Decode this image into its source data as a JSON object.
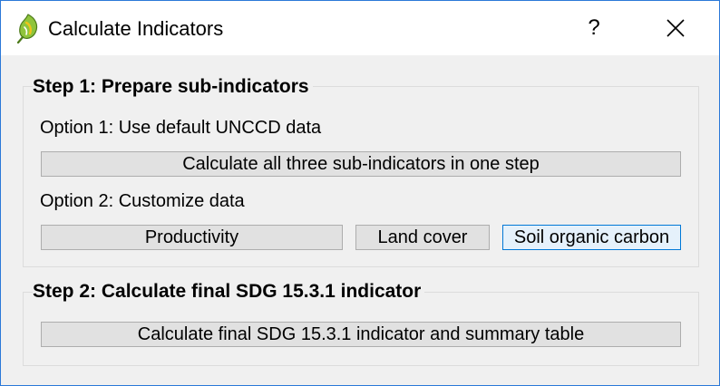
{
  "window": {
    "title": "Calculate Indicators",
    "help_label": "?",
    "close_label": "✕"
  },
  "step1": {
    "title": "Step 1: Prepare sub-indicators",
    "option1_label": "Option 1: Use default UNCCD data",
    "calc_all_button": "Calculate all three sub-indicators in one step",
    "option2_label": "Option 2: Customize data",
    "productivity_button": "Productivity",
    "land_cover_button": "Land cover",
    "soil_carbon_button": "Soil organic carbon"
  },
  "step2": {
    "title": "Step 2: Calculate final SDG 15.3.1 indicator",
    "final_button": "Calculate final SDG 15.3.1 indicator and summary table"
  },
  "colors": {
    "accent": "#0078d7",
    "window_border": "#2b79d8",
    "button_bg": "#e1e1e1",
    "dialog_bg": "#f0f0f0"
  },
  "icons": {
    "app_icon": "qgis-logo-icon"
  }
}
